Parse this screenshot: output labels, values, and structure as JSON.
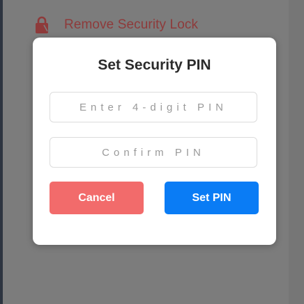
{
  "background": {
    "menu_item": {
      "icon": "lock-icon",
      "label": "Remove Security Lock",
      "color": "#8e3a3a"
    }
  },
  "dialog": {
    "title": "Set Security PIN",
    "pin_input": {
      "placeholder": "Enter 4-digit PIN",
      "value": ""
    },
    "confirm_input": {
      "placeholder": "Confirm PIN",
      "value": ""
    },
    "cancel_label": "Cancel",
    "set_pin_label": "Set PIN",
    "colors": {
      "cancel": "#f26b6b",
      "primary": "#0a7cf5"
    }
  }
}
